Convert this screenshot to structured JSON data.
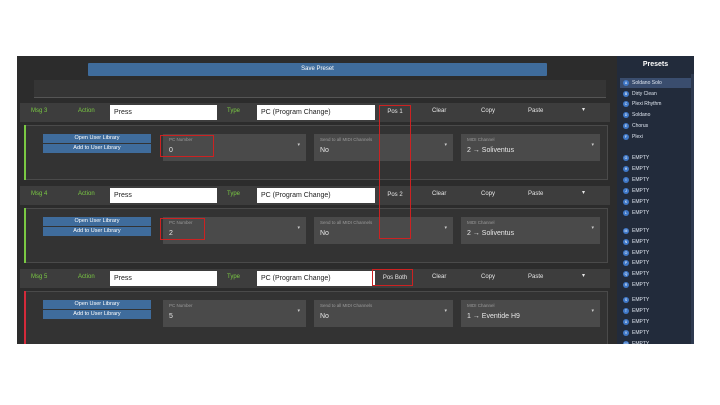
{
  "toolbar": {
    "save_label": "Save Preset"
  },
  "labels": {
    "action": "Action",
    "type": "Type",
    "clear": "Clear",
    "copy": "Copy",
    "paste": "Paste",
    "caret": "▾"
  },
  "library": {
    "open": "Open User Library",
    "add": "Add to User Library"
  },
  "params": {
    "pc_number": "PC Number",
    "send_all": "Send to all MIDI Channels",
    "midi_channel": "MIDI Channel"
  },
  "messages": [
    {
      "label": "Msg 3",
      "action": "Press",
      "type": "PC (Program Change)",
      "pos": "Pos 1",
      "pc_number": "0",
      "send_all": "No",
      "midi_channel": "2 → Soliventus",
      "accent": "#7ac943"
    },
    {
      "label": "Msg 4",
      "action": "Press",
      "type": "PC (Program Change)",
      "pos": "Pos 2",
      "pc_number": "2",
      "send_all": "No",
      "midi_channel": "2 → Soliventus",
      "accent": "#7ac943"
    },
    {
      "label": "Msg 5",
      "action": "Press",
      "type": "PC (Program Change)",
      "pos": "Pos Both",
      "pc_number": "5",
      "send_all": "No",
      "midi_channel": "1 → Eventide H9",
      "accent": "#d42a3a"
    }
  ],
  "presets": {
    "title": "Presets",
    "items": [
      {
        "letter": "A",
        "name": "Soldano Solo",
        "selected": true
      },
      {
        "letter": "B",
        "name": "Dirty Clean"
      },
      {
        "letter": "C",
        "name": "Plexi Rhythm"
      },
      {
        "letter": "D",
        "name": "Soldano"
      },
      {
        "letter": "E",
        "name": "Chorus"
      },
      {
        "letter": "F",
        "name": "Plexi"
      },
      {
        "letter": "G",
        "name": "EMPTY"
      },
      {
        "letter": "H",
        "name": "EMPTY"
      },
      {
        "letter": "I",
        "name": "EMPTY"
      },
      {
        "letter": "J",
        "name": "EMPTY"
      },
      {
        "letter": "K",
        "name": "EMPTY"
      },
      {
        "letter": "L",
        "name": "EMPTY"
      },
      {
        "letter": "M",
        "name": "EMPTY"
      },
      {
        "letter": "N",
        "name": "EMPTY"
      },
      {
        "letter": "O",
        "name": "EMPTY"
      },
      {
        "letter": "P",
        "name": "EMPTY"
      },
      {
        "letter": "Q",
        "name": "EMPTY"
      },
      {
        "letter": "R",
        "name": "EMPTY"
      },
      {
        "letter": "S",
        "name": "EMPTY"
      },
      {
        "letter": "T",
        "name": "EMPTY"
      },
      {
        "letter": "U",
        "name": "EMPTY"
      },
      {
        "letter": "V",
        "name": "EMPTY"
      },
      {
        "letter": "W",
        "name": "EMPTY"
      }
    ]
  },
  "colors": {
    "annotation": "#cc2222",
    "button": "#3f6c9c",
    "green": "#7ac943"
  }
}
